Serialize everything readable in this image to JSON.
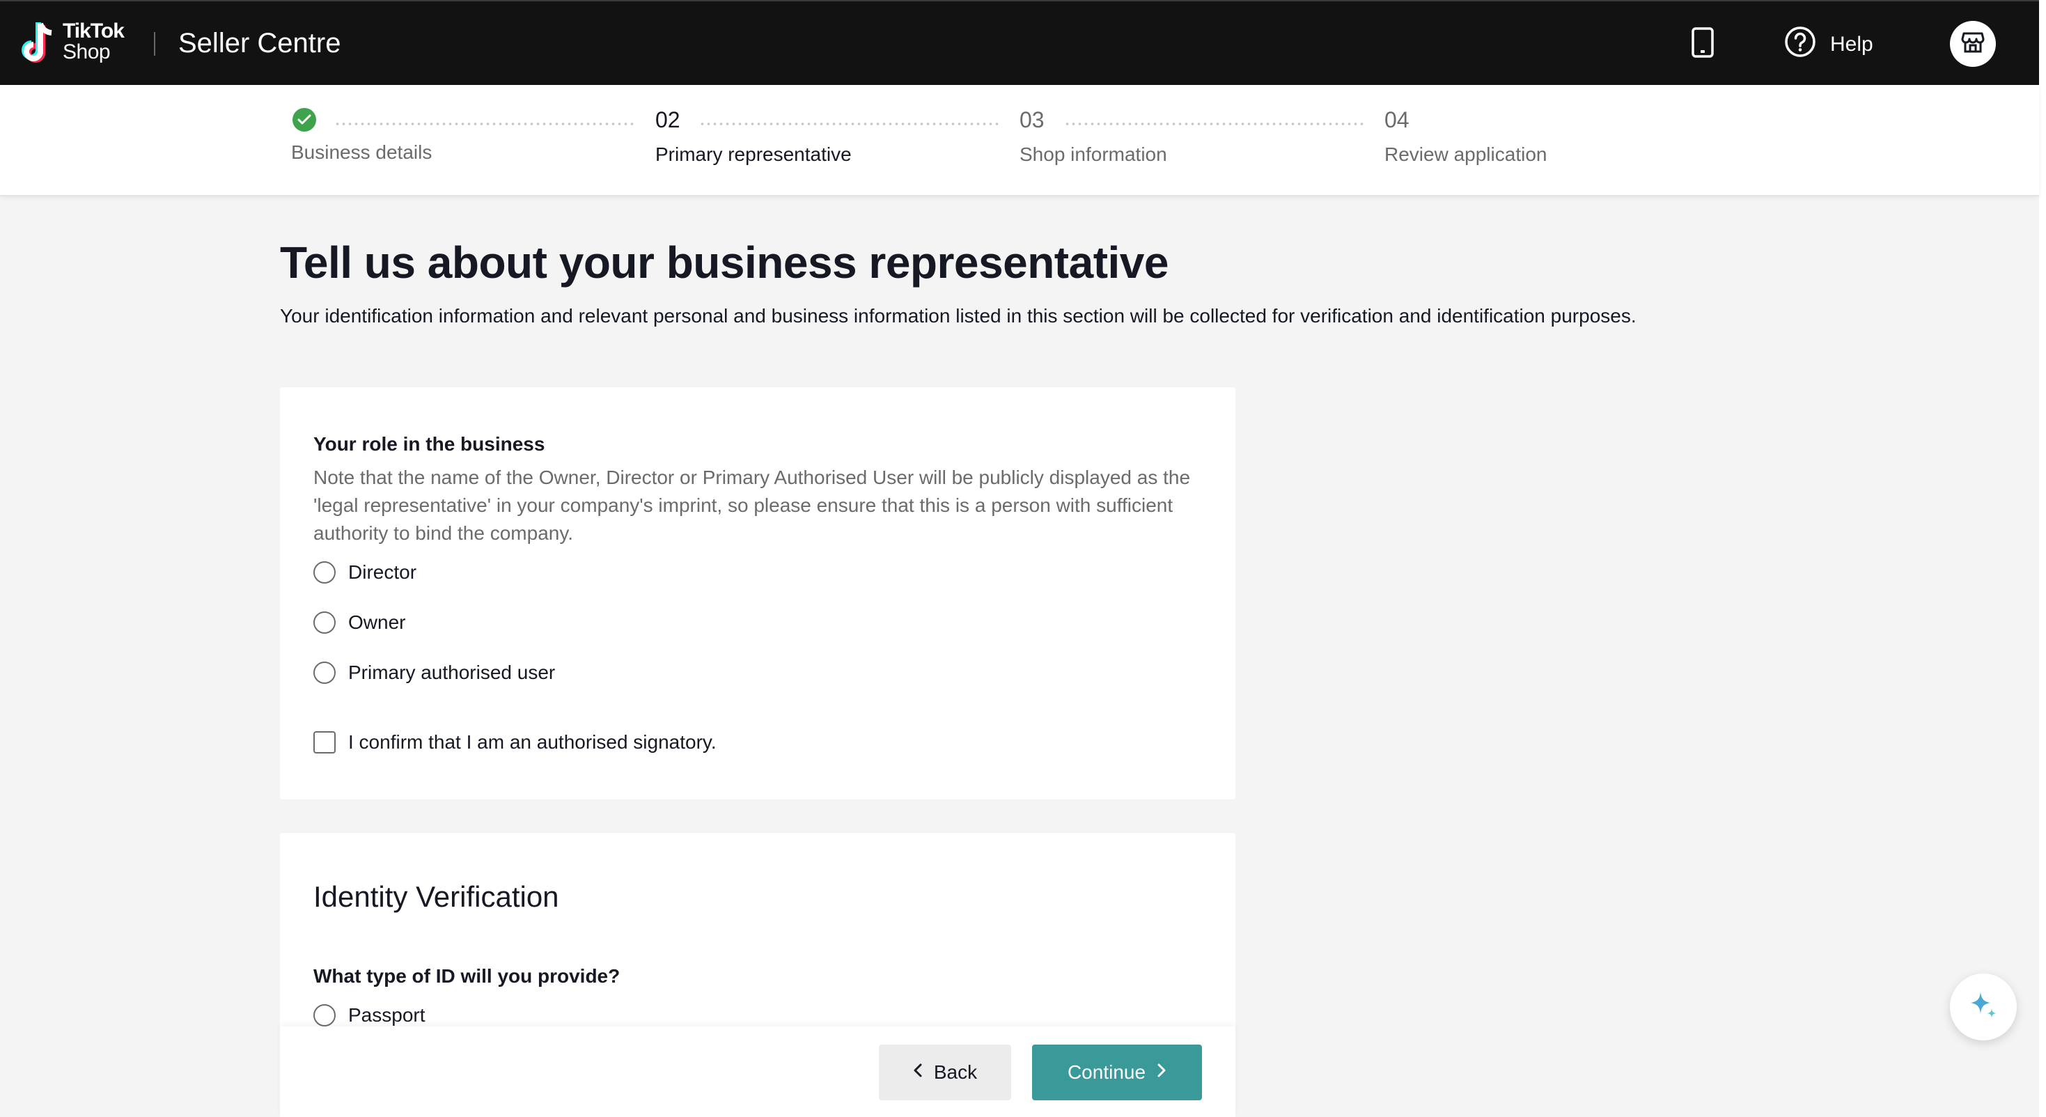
{
  "header": {
    "logo_line1": "TikTok",
    "logo_line2": "Shop",
    "app_title": "Seller Centre",
    "help_label": "Help",
    "icons": {
      "phone": "mobile-phone-icon",
      "help": "question-circle-icon",
      "store": "store-icon"
    }
  },
  "stepper": {
    "steps": [
      {
        "num": "",
        "label": "Business details",
        "status": "completed"
      },
      {
        "num": "02",
        "label": "Primary representative",
        "status": "current"
      },
      {
        "num": "03",
        "label": "Shop information",
        "status": "upcoming"
      },
      {
        "num": "04",
        "label": "Review application",
        "status": "upcoming"
      }
    ]
  },
  "main": {
    "title": "Tell us about your business representative",
    "subtitle": "Your identification information and relevant personal and business information listed in this section will be collected for verification and identification purposes."
  },
  "role_card": {
    "question": "Your role in the business",
    "note": "Note that the name of the Owner, Director or Primary Authorised User will be publicly displayed as the 'legal representative' in your company's imprint, so please ensure that this is a person with sufficient authority to bind the company.",
    "options": [
      "Director",
      "Owner",
      "Primary authorised user"
    ],
    "confirm_label": "I confirm that I am an authorised signatory."
  },
  "identity_card": {
    "title": "Identity Verification",
    "question": "What type of ID will you provide?",
    "options": [
      "Passport"
    ]
  },
  "footer": {
    "back_label": "Back",
    "continue_label": "Continue"
  },
  "colors": {
    "topbar": "#121212",
    "accent": "#3a9999",
    "success": "#3fa34d",
    "page_bg": "#f4f4f4"
  }
}
